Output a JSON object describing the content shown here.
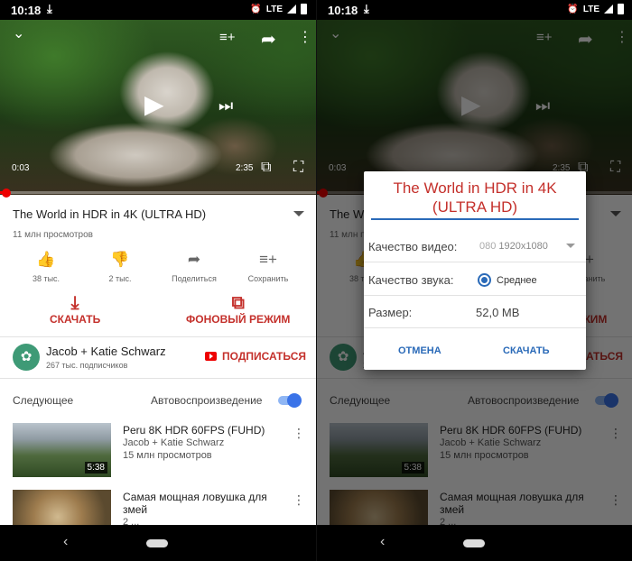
{
  "statusbar": {
    "time": "10:18",
    "network": "LTE"
  },
  "player": {
    "current_time": "0:03",
    "duration": "2:35",
    "progress": 0.019
  },
  "video": {
    "title": "The World in HDR in 4K (ULTRA HD)",
    "views": "11 млн просмотров"
  },
  "actions": [
    {
      "label": "38 тыс.",
      "icon": "thumb-up-icon",
      "glyph": "👍"
    },
    {
      "label": "2 тыс.",
      "icon": "thumb-down-icon",
      "glyph": "👎"
    },
    {
      "label": "Поделиться",
      "icon": "share-icon",
      "glyph": "➦"
    },
    {
      "label": "Сохранить",
      "icon": "add-to-playlist-icon",
      "glyph": "≡+"
    }
  ],
  "download": {
    "label": "СКАЧАТЬ"
  },
  "background_mode": {
    "label": "ФОНОВЫЙ РЕЖИМ"
  },
  "channel": {
    "name": "Jacob + Katie Schwarz",
    "subscribers": "267 тыс. подписчиков",
    "subscribe_label": "ПОДПИСАТЬСЯ"
  },
  "upnext": {
    "label": "Следующее",
    "autoplay_label": "Автовоспроизведение",
    "autoplay_on": true
  },
  "videos": [
    {
      "title": "Peru 8K HDR 60FPS (FUHD)",
      "channel": "Jacob + Katie Schwarz",
      "views": "15 млн просмотров",
      "duration": "5:38"
    },
    {
      "title": "Самая мощная ловушка для змей",
      "channel": "2 ...",
      "views": "",
      "duration": ""
    }
  ],
  "dialog": {
    "title": "The World in HDR in 4K (ULTRA HD)",
    "video_quality_label": "Качество видео:",
    "video_quality_prefix": "080",
    "video_quality_value": "1920x1080",
    "audio_quality_label": "Качество звука:",
    "audio_quality_value": "Среднее",
    "size_label": "Размер:",
    "size_value": "52,0 MB",
    "cancel_label": "ОТМЕНА",
    "download_label": "СКАЧАТЬ"
  },
  "colors": {
    "accent_red": "#c4302b",
    "accent_blue": "#2a6ab8",
    "toggle_blue": "#3a73e8"
  }
}
